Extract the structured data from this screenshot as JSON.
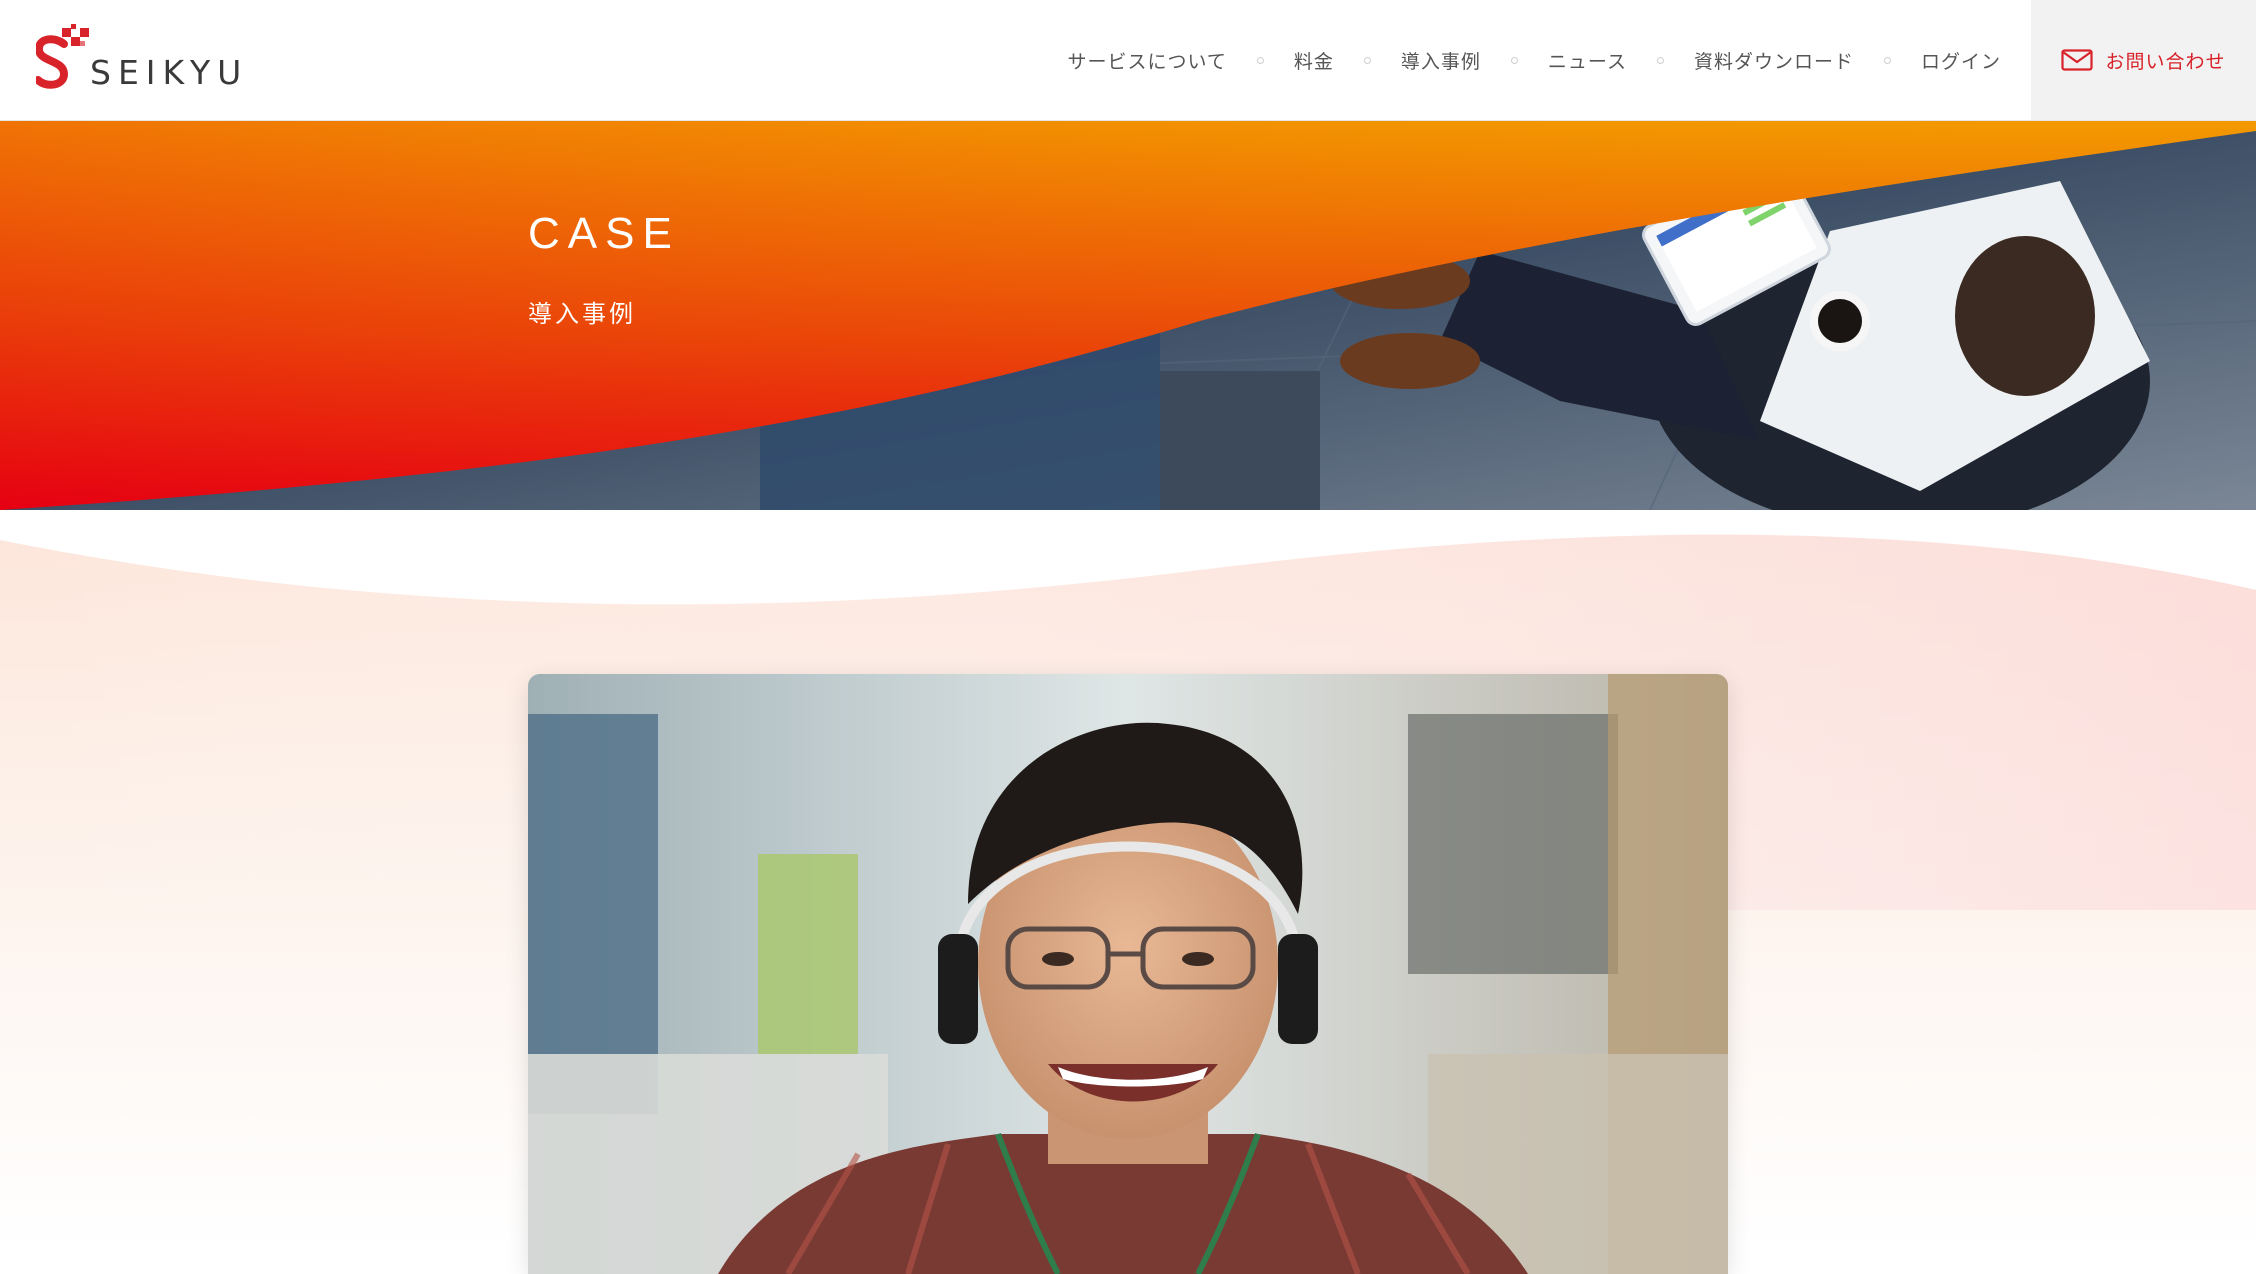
{
  "header": {
    "logo_text": "SEIKYU",
    "nav": [
      {
        "label": "サービスについて"
      },
      {
        "label": "料金"
      },
      {
        "label": "導入事例"
      },
      {
        "label": "ニュース"
      },
      {
        "label": "資料ダウンロード"
      },
      {
        "label": "ログイン"
      }
    ],
    "contact_label": "お問い合わせ",
    "contact_icon": "mail-icon"
  },
  "hero": {
    "title": "CASE",
    "subtitle": "導入事例"
  },
  "colors": {
    "brand_red": "#d8232a",
    "gradient_top": "#f39a00",
    "gradient_bottom": "#e60012",
    "nav_text": "#555555"
  }
}
